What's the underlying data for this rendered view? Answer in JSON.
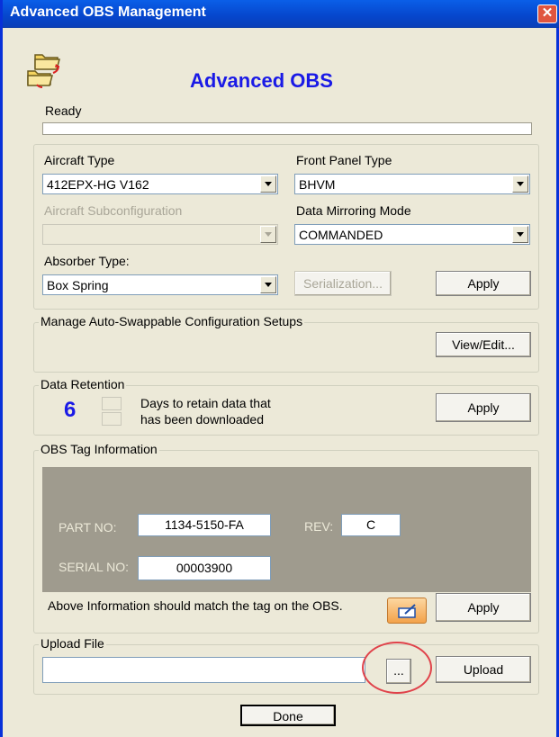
{
  "window": {
    "title": "Advanced OBS Management",
    "close_glyph": "✕"
  },
  "header": {
    "app_title": "Advanced OBS",
    "status": "Ready",
    "progress_fraction": 0.0,
    "icon": "obs-folders-icon"
  },
  "config": {
    "aircraft_type_label": "Aircraft Type",
    "aircraft_type_value": "412EPX-HG V162",
    "front_panel_label": "Front Panel Type",
    "front_panel_value": "BHVM",
    "subconfig_label": "Aircraft Subconfiguration",
    "subconfig_value": "",
    "mirroring_label": "Data Mirroring Mode",
    "mirroring_value": "COMMANDED",
    "absorber_label": "Absorber Type:",
    "absorber_value": "Box Spring",
    "serialization_label": "Serialization...",
    "apply_label": "Apply"
  },
  "swappable": {
    "legend": "Manage Auto-Swappable Configuration Setups",
    "view_edit_label": "View/Edit..."
  },
  "retention": {
    "legend": "Data Retention",
    "days_value": "6",
    "desc_line1": "Days to retain data that",
    "desc_line2": "has been downloaded",
    "apply_label": "Apply"
  },
  "tag": {
    "legend": "OBS Tag Information",
    "part_no_label": "PART NO:",
    "part_no_value": "1134-5150-FA",
    "rev_label": "REV:",
    "rev_value": "C",
    "serial_no_label": "SERIAL NO:",
    "serial_no_value": "00003900",
    "note": "Above Information should match the tag on the OBS.",
    "edit_icon": "edit-tag-icon",
    "apply_label": "Apply"
  },
  "upload": {
    "legend": "Upload File",
    "file_value": "",
    "browse_label": "...",
    "upload_label": "Upload",
    "highlight_color": "#E0424A"
  },
  "footer": {
    "done_label": "Done"
  },
  "colors": {
    "title_bar": "#0646CC",
    "app_title": "#1A1AE6",
    "days_value": "#1A1AE6",
    "window_bg": "#ECE9D8",
    "tag_panel": "#9F9B8E"
  }
}
